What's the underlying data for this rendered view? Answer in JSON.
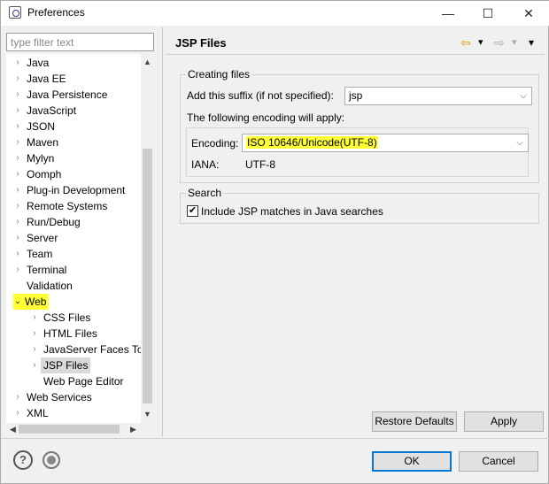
{
  "window": {
    "title": "Preferences",
    "minimize": "—",
    "maximize": "☐",
    "close": "✕"
  },
  "filter": {
    "placeholder": "type filter text",
    "value": ""
  },
  "tree": {
    "items": [
      {
        "label": "Java",
        "arrow": "›",
        "indent": 0
      },
      {
        "label": "Java EE",
        "arrow": "›",
        "indent": 0
      },
      {
        "label": "Java Persistence",
        "arrow": "›",
        "indent": 0
      },
      {
        "label": "JavaScript",
        "arrow": "›",
        "indent": 0
      },
      {
        "label": "JSON",
        "arrow": "›",
        "indent": 0
      },
      {
        "label": "Maven",
        "arrow": "›",
        "indent": 0
      },
      {
        "label": "Mylyn",
        "arrow": "›",
        "indent": 0
      },
      {
        "label": "Oomph",
        "arrow": "›",
        "indent": 0
      },
      {
        "label": "Plug-in Development",
        "arrow": "›",
        "indent": 0
      },
      {
        "label": "Remote Systems",
        "arrow": "›",
        "indent": 0
      },
      {
        "label": "Run/Debug",
        "arrow": "›",
        "indent": 0
      },
      {
        "label": "Server",
        "arrow": "›",
        "indent": 0
      },
      {
        "label": "Team",
        "arrow": "›",
        "indent": 0
      },
      {
        "label": "Terminal",
        "arrow": "›",
        "indent": 0
      },
      {
        "label": "Validation",
        "arrow": "",
        "indent": 0
      },
      {
        "label": "Web",
        "arrow": "⌄",
        "indent": 0,
        "highlighted": true
      },
      {
        "label": "CSS Files",
        "arrow": "›",
        "indent": 1
      },
      {
        "label": "HTML Files",
        "arrow": "›",
        "indent": 1
      },
      {
        "label": "JavaServer Faces To",
        "arrow": "›",
        "indent": 1
      },
      {
        "label": "JSP Files",
        "arrow": "›",
        "indent": 1,
        "selected": true
      },
      {
        "label": "Web Page Editor",
        "arrow": "",
        "indent": 1
      },
      {
        "label": "Web Services",
        "arrow": "›",
        "indent": 0
      },
      {
        "label": "XML",
        "arrow": "›",
        "indent": 0
      }
    ],
    "scroll_up": "▲",
    "scroll_down": "▼",
    "scroll_left": "◀",
    "scroll_right": "▶"
  },
  "page": {
    "title": "JSP Files",
    "nav_back": "⇦",
    "nav_back_menu": "▾",
    "nav_forward": "⇨",
    "nav_forward_menu": "▾",
    "view_menu": "▾"
  },
  "creating_files": {
    "group_label": "Creating files",
    "suffix_label": "Add this suffix (if not specified):",
    "suffix_value": "jsp",
    "encoding_note": "The following encoding will apply:",
    "encoding_label": "Encoding:",
    "encoding_value": "ISO 10646/Unicode(UTF-8)",
    "iana_label": "IANA:",
    "iana_value": "UTF-8"
  },
  "search": {
    "group_label": "Search",
    "checkbox_label": "Include JSP matches in Java searches",
    "checked": true,
    "check_mark": "✔"
  },
  "buttons": {
    "restore_defaults": "Restore Defaults",
    "apply": "Apply",
    "ok": "OK",
    "cancel": "Cancel"
  },
  "footer": {
    "help_glyph": "?"
  },
  "colors": {
    "highlight": "#ffff33",
    "selection": "#d9d9d9",
    "default_button_border": "#0078d7"
  }
}
